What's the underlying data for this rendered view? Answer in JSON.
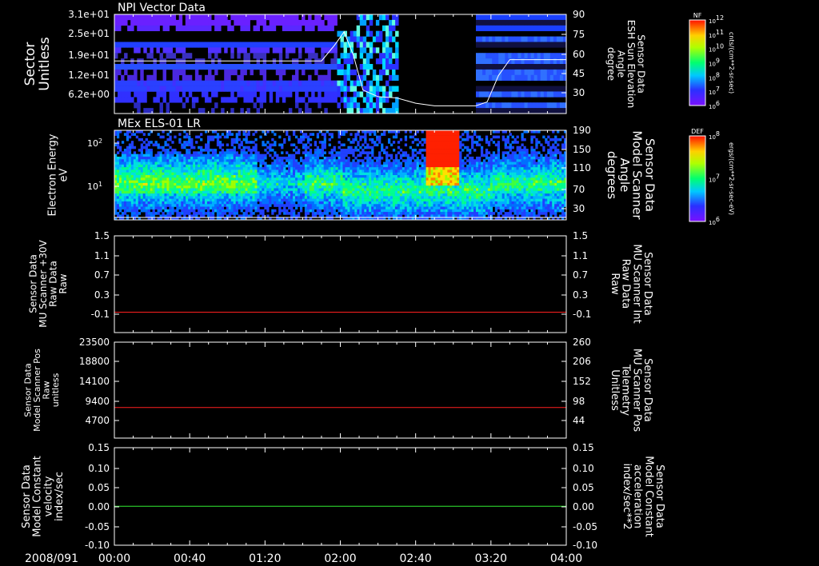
{
  "colors": {
    "background": "#000000",
    "frame": "#ffffff",
    "red_trace": "#ff2020",
    "green_trace": "#33ee33",
    "right_label_red": "#ff2020",
    "right_label_green": "#33ee33"
  },
  "x_axis": {
    "date_label": "2008/091",
    "ticks": [
      "00:00",
      "00:40",
      "01:20",
      "02:00",
      "02:40",
      "03:20",
      "04:00"
    ],
    "range": [
      "00:00",
      "04:00"
    ]
  },
  "chart_data": [
    {
      "type": "heatmap",
      "title": "NPI Vector Data",
      "ylabel_lines": [
        "Sector",
        "Unitless"
      ],
      "yticks": [
        "3.1e+01",
        "2.5e+01",
        "1.9e+01",
        "1.2e+01",
        "6.2e+00"
      ],
      "right_label_lines": [
        "Sensor Data",
        "ESH Sun Elevation",
        "Angle",
        "degree"
      ],
      "right_ticks": [
        "90",
        "75",
        "60",
        "45",
        "30"
      ],
      "right_ylim": [
        15,
        90
      ],
      "colorbar": {
        "label": "NF",
        "units": "cnts/(cm**2-sr-sec)",
        "ticks": [
          "10^12",
          "10^11",
          "10^10",
          "10^9",
          "10^8",
          "10^7",
          "10^6"
        ]
      },
      "overlay_line": {
        "name": "ESH Sun Elevation Angle",
        "color": "#ffffff",
        "x": [
          "00:00",
          "01:50",
          "01:57",
          "02:02",
          "02:07",
          "02:12",
          "02:20",
          "02:30",
          "02:40",
          "02:50",
          "03:00",
          "03:12",
          "03:18",
          "03:24",
          "03:30",
          "04:00"
        ],
        "y": [
          56,
          56,
          68,
          78,
          60,
          34,
          29,
          28,
          24,
          22,
          22,
          22,
          25,
          45,
          57,
          57
        ]
      }
    },
    {
      "type": "heatmap",
      "title": "MEx ELS-01 LR",
      "ylabel_lines": [
        "Electron Energy",
        "eV"
      ],
      "yticks": [
        "10^2",
        "10^1"
      ],
      "right_label_lines": [
        "Sensor Data",
        "Model Scanner",
        "Angle",
        "degrees"
      ],
      "right_ticks": [
        "190",
        "150",
        "110",
        "70",
        "30"
      ],
      "colorbar": {
        "label": "DEF",
        "units": "ergs/(cm**2-sr-sec-eV)",
        "ticks": [
          "10^8",
          "10^7",
          "10^6"
        ]
      }
    },
    {
      "type": "line",
      "ylabel_lines": [
        "Sensor Data",
        "MU Scanner +30V",
        "Raw Data",
        "Raw"
      ],
      "yticks": [
        "1.5",
        "1.1",
        "0.7",
        "0.3",
        "-0.1"
      ],
      "ylim": [
        -0.4,
        1.5
      ],
      "right_label_lines": [
        "Sensor Data",
        "MU Scanner Int",
        "Raw Data",
        "Raw"
      ],
      "right_ticks": [
        "1.5",
        "1.1",
        "0.7",
        "0.3",
        "-0.1"
      ],
      "series": [
        {
          "color": "#ff2020",
          "x": [
            "00:00",
            "04:00"
          ],
          "y": [
            0.0,
            0.0
          ]
        }
      ]
    },
    {
      "type": "line",
      "ylabel_lines": [
        "Sensor Data",
        "Model Scanner Pos",
        "Raw",
        "unitless"
      ],
      "yticks": [
        "23500",
        "18800",
        "14100",
        "9400",
        "4700"
      ],
      "ylim": [
        0,
        23500
      ],
      "right_label_lines": [
        "Sensor Data",
        "MU Scanner Pos",
        "Telemetry",
        "Unitless"
      ],
      "right_ticks": [
        "260",
        "206",
        "152",
        "98",
        "44"
      ],
      "series": [
        {
          "color": "#ff2020",
          "x": [
            "00:00",
            "04:00"
          ],
          "y": [
            7500,
            7500
          ]
        }
      ]
    },
    {
      "type": "line",
      "ylabel_lines": [
        "Sensor Data",
        "Model Constant",
        "velocity",
        "index/sec"
      ],
      "yticks": [
        "0.15",
        "0.10",
        "0.05",
        "0.00",
        "-0.05",
        "-0.10"
      ],
      "ylim": [
        -0.1,
        0.15
      ],
      "right_label_lines": [
        "Sensor Data",
        "Model Constant",
        "acceleration",
        "index/sec**2"
      ],
      "right_ticks": [
        "0.15",
        "0.10",
        "0.05",
        "0.00",
        "-0.05",
        "-0.10"
      ],
      "series": [
        {
          "color": "#33ee33",
          "x": [
            "00:00",
            "04:00"
          ],
          "y": [
            0.0,
            0.0
          ]
        }
      ]
    }
  ]
}
